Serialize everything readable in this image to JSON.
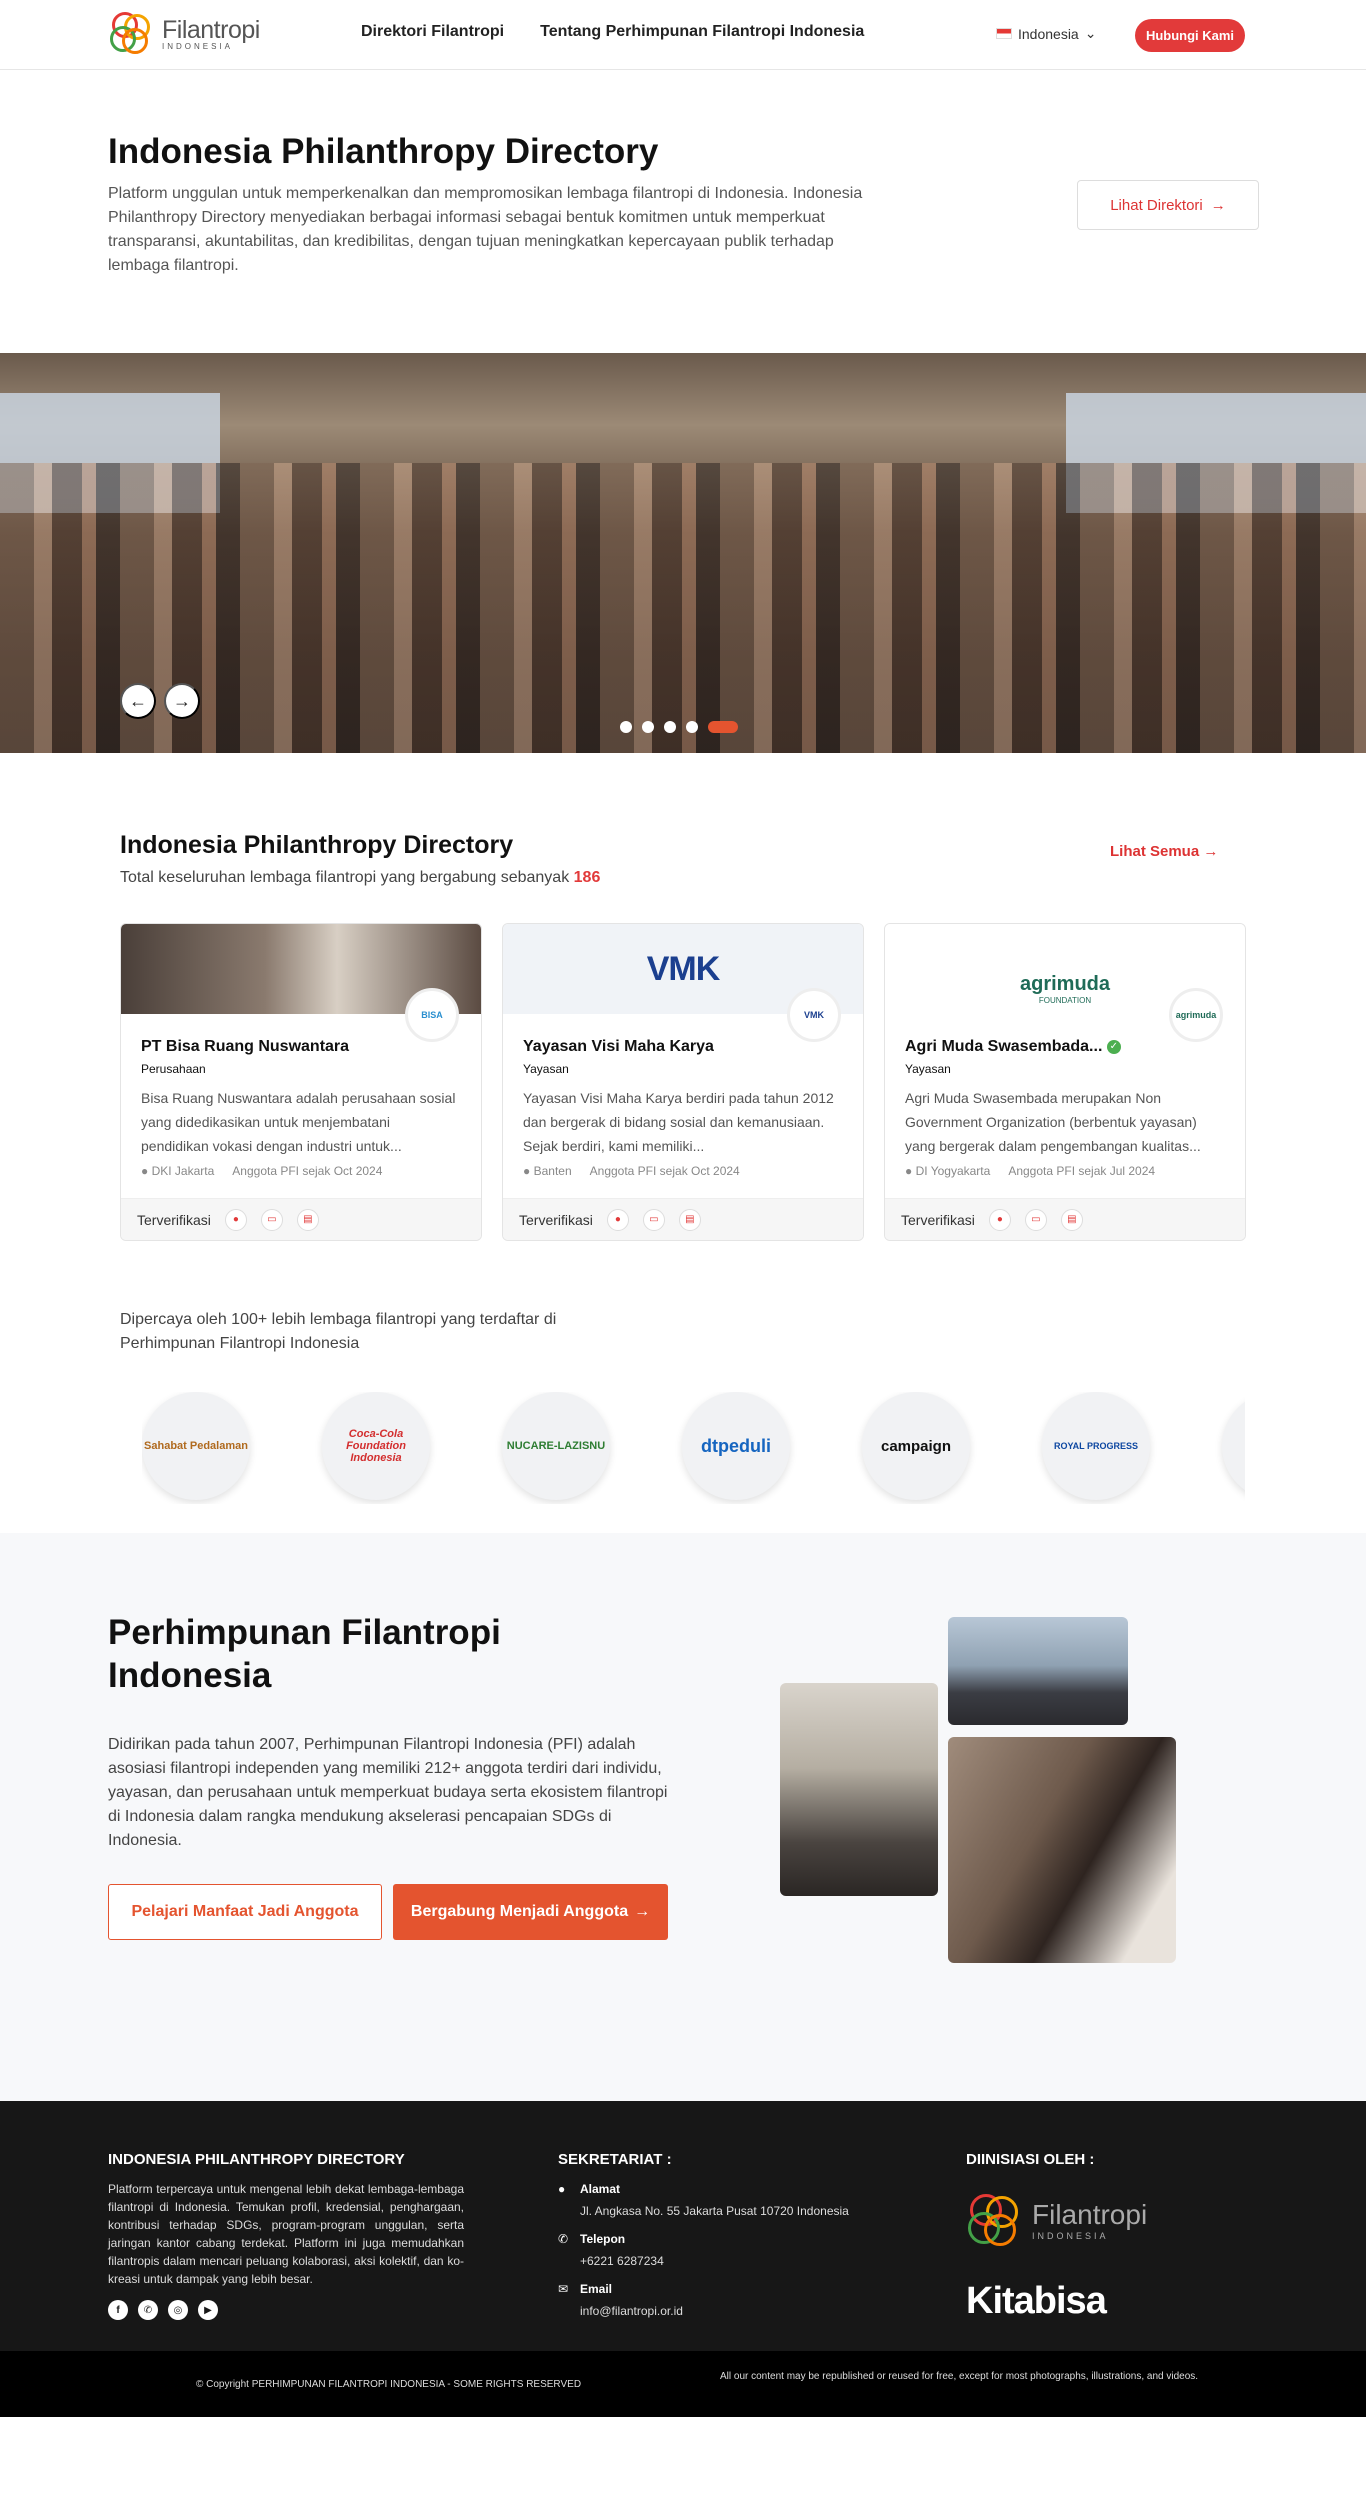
{
  "header": {
    "logo_name": "Filantropi",
    "logo_sub": "INDONESIA",
    "nav": [
      "Direktori Filantropi",
      "Tentang Perhimpunan Filantropi Indonesia"
    ],
    "language": "Indonesia",
    "contact_button": "Hubungi Kami"
  },
  "hero": {
    "title": "Indonesia Philanthropy Directory",
    "description": "Platform unggulan untuk memperkenalkan dan mempromosikan lembaga filantropi di Indonesia. Indonesia Philanthropy Directory menyediakan berbagai informasi sebagai bentuk komitmen untuk memperkuat transparansi, akuntabilitas, dan kredibilitas, dengan tujuan meningkatkan kepercayaan publik terhadap lembaga filantropi.",
    "button": "Lihat Direktori"
  },
  "carousel": {
    "prev": "←",
    "next": "→",
    "slides": 5,
    "active_slide": 5
  },
  "directory": {
    "title": "Indonesia Philanthropy Directory",
    "total_text": "Total keseluruhan lembaga filantropi yang bergabung sebanyak",
    "total_count": "186",
    "see_all": "Lihat Semua",
    "cards": [
      {
        "name": "PT Bisa Ruang Nuswantara",
        "type": "Perusahaan",
        "description": "Bisa Ruang Nuswantara adalah perusahaan sosial yang didedikasikan untuk menjembatani pendidikan vokasi dengan industri untuk...",
        "location": "DKI Jakarta",
        "member_since": "Anggota PFI sejak Oct 2024",
        "verified_label": "Terverifikasi",
        "avatar": "BISA"
      },
      {
        "name": "Yayasan Visi Maha Karya",
        "type": "Yayasan",
        "description": "Yayasan Visi Maha Karya berdiri pada tahun 2012 dan bergerak di bidang sosial dan kemanusiaan. Sejak berdiri, kami memiliki...",
        "location": "Banten",
        "member_since": "Anggota PFI sejak Oct 2024",
        "verified_label": "Terverifikasi",
        "banner_logo": "VMK",
        "avatar": "VMK"
      },
      {
        "name": "Agri Muda Swasembada...",
        "type": "Yayasan",
        "description": "Agri Muda Swasembada merupakan Non Government Organization (berbentuk yayasan) yang bergerak dalam pengembangan kualitas...",
        "location": "DI Yogyakarta",
        "member_since": "Anggota PFI sejak Jul 2024",
        "verified_label": "Terverifikasi",
        "banner_logo": "agrimuda",
        "banner_sub": "FOUNDATION",
        "avatar": "agrimuda"
      }
    ]
  },
  "trusted": {
    "text": "Dipercaya oleh 100+ lebih lembaga filantropi yang terdaftar di Perhimpunan Filantropi Indonesia",
    "logos": [
      "Sahabat Pedalaman",
      "Coca-Cola Foundation Indonesia",
      "NUCARE-LAZISNU",
      "dtpeduli",
      "campaign",
      "ROYAL PROGRESS",
      ""
    ]
  },
  "about": {
    "title": "Perhimpunan Filantropi Indonesia",
    "description": "Didirikan pada tahun 2007, Perhimpunan Filantropi Indonesia (PFI) adalah asosiasi filantropi independen yang memiliki 212+ anggota terdiri dari individu, yayasan, dan perusahaan untuk memperkuat budaya serta ekosistem filantropi di Indonesia dalam rangka mendukung akselerasi pencapaian SDGs di Indonesia.",
    "button_learn": "Pelajari Manfaat Jadi Anggota",
    "button_join": "Bergabung Menjadi Anggota"
  },
  "footer": {
    "col1_title": "INDONESIA PHILANTHROPY DIRECTORY",
    "col1_text": "Platform terpercaya untuk mengenal lebih dekat lembaga-lembaga filantropi di Indonesia. Temukan profil, kredensial, penghargaan, kontribusi terhadap SDGs, program-program unggulan, serta jaringan kantor cabang terdekat. Platform ini juga memudahkan filantropis dalam mencari peluang kolaborasi, aksi kolektif, dan ko-kreasi untuk dampak yang lebih besar.",
    "col2_title": "SEKRETARIAT :",
    "address_label": "Alamat",
    "address": "Jl. Angkasa No. 55 Jakarta Pusat 10720 Indonesia",
    "phone_label": "Telepon",
    "phone": "+6221 6287234",
    "email_label": "Email",
    "email": "info@filantropi.or.id",
    "col3_title": "DIINISIASI OLEH :",
    "partner1_name": "Filantropi",
    "partner1_sub": "INDONESIA",
    "partner2": "Kitabisa",
    "copyright": "© Copyright PERHIMPUNAN FILANTROPI INDONESIA - SOME RIGHTS RESERVED",
    "notice": "All our content may be republished or reused for free, except for most photographs, illustrations, and videos."
  },
  "colors": {
    "brand_red": "#e23a3a",
    "accent_orange": "#e4542f",
    "footer_bg": "#171717"
  }
}
